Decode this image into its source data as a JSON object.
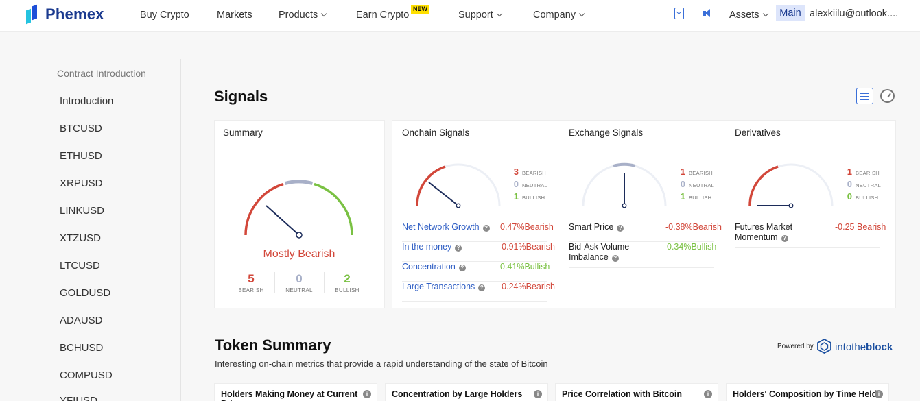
{
  "header": {
    "brand": "Phemex",
    "nav": {
      "buy_crypto": "Buy Crypto",
      "markets": "Markets",
      "products": "Products",
      "earn_crypto": "Earn Crypto",
      "new_badge": "NEW",
      "support": "Support",
      "company": "Company"
    },
    "assets": "Assets",
    "account_type": "Main",
    "user_email": "alexkiilu@outlook...."
  },
  "sidebar": {
    "title": "Contract Introduction",
    "items": [
      "Introduction",
      "BTCUSD",
      "ETHUSD",
      "XRPUSD",
      "LINKUSD",
      "XTZUSD",
      "LTCUSD",
      "GOLDUSD",
      "ADAUSD",
      "BCHUSD",
      "COMPUSD",
      "YFIUSD"
    ]
  },
  "signals": {
    "title": "Signals",
    "summary": {
      "heading": "Summary",
      "status": "Mostly Bearish",
      "bearish_count": "5",
      "neutral_count": "0",
      "bullish_count": "2",
      "bearish_label": "BEARISH",
      "neutral_label": "NEUTRAL",
      "bullish_label": "BULLISH",
      "gauge_level": 0.25
    },
    "onchain": {
      "heading": "Onchain Signals",
      "bearish": "3",
      "neutral": "0",
      "bullish": "1",
      "gauge_level": 0.2,
      "rows": [
        {
          "name": "Net Network Growth",
          "value": "0.47%",
          "signal": "Bearish"
        },
        {
          "name": "In the money",
          "value": "-0.91%",
          "signal": "Bearish"
        },
        {
          "name": "Concentration",
          "value": "0.41%",
          "signal": "Bullish"
        },
        {
          "name": "Large Transactions",
          "value": "-0.24%",
          "signal": "Bearish"
        }
      ]
    },
    "exchange": {
      "heading": "Exchange Signals",
      "bearish": "1",
      "neutral": "0",
      "bullish": "1",
      "gauge_level": 0.5,
      "rows": [
        {
          "name": "Smart Price",
          "value": "-0.38%",
          "signal": "Bearish"
        },
        {
          "name": "Bid-Ask Volume Imbalance",
          "value": "0.34%",
          "signal": "Bullish"
        }
      ]
    },
    "derivatives": {
      "heading": "Derivatives",
      "bearish": "1",
      "neutral": "0",
      "bullish": "0",
      "gauge_level": 0.0,
      "rows": [
        {
          "name": "Futures Market Momentum",
          "value": "-0.25",
          "signal": "Bearish"
        }
      ]
    },
    "bearish_label": "BEARISH",
    "neutral_label": "NEUTRAL",
    "bullish_label": "BULLISH"
  },
  "token_summary": {
    "title": "Token Summary",
    "subtitle": "Interesting on-chain metrics that provide a rapid understanding of the state of Bitcoin",
    "powered_by": "Powered by",
    "provider_a": "intothe",
    "provider_b": "block",
    "cards": [
      "Holders Making Money at Current Price",
      "Concentration by Large Holders",
      "Price Correlation with Bitcoin",
      "Holders' Composition by Time Held"
    ]
  },
  "colors": {
    "bearish": "#d2473a",
    "neutral": "#a8b0c8",
    "bullish": "#7ac143",
    "brand": "#1b3a8f",
    "link": "#2f5ec4"
  }
}
